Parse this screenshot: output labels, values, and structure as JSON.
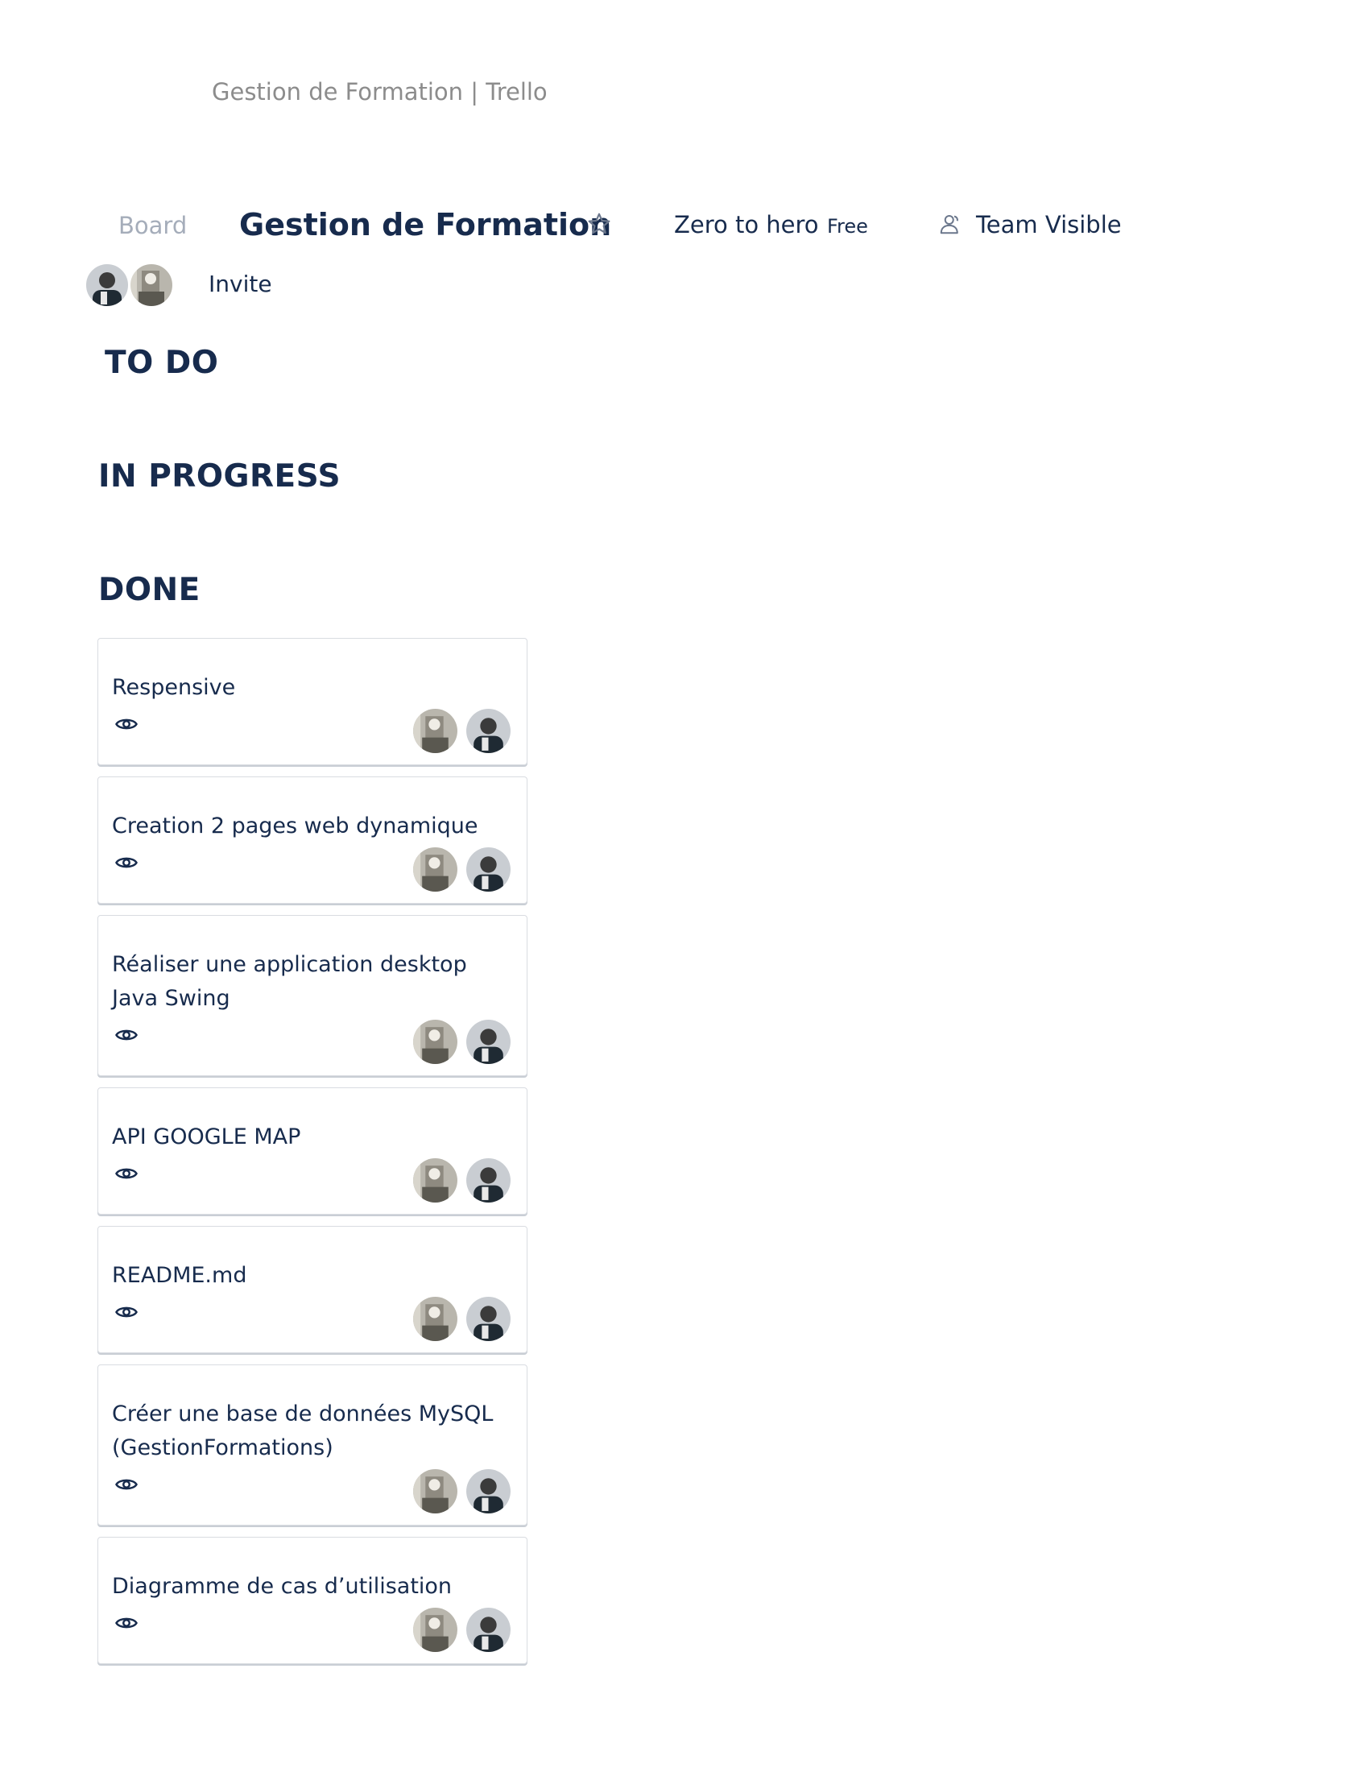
{
  "document": {
    "title": "Gestion de Formation | Trello"
  },
  "header": {
    "board_link": "Board",
    "board_title": "Gestion de Formation",
    "star_icon": "star-icon",
    "workspace": "Zero to hero",
    "plan": "Free",
    "visibility_icon": "team-icon",
    "visibility": "Team Visible"
  },
  "members": {
    "invite_label": "Invite"
  },
  "lists": [
    {
      "title": "TO DO",
      "cards": []
    },
    {
      "title": "IN PROGRESS",
      "cards": []
    },
    {
      "title": "DONE",
      "cards": [
        {
          "title": "Respensive"
        },
        {
          "title": "Creation 2 pages web dynamique"
        },
        {
          "title": "Réaliser une application desktop Java Swing"
        },
        {
          "title": "API GOOGLE MAP"
        },
        {
          "title": "README.md"
        },
        {
          "title": "Créer une base de données MySQL (GestionFormations)"
        },
        {
          "title": "Diagramme de cas d’utilisation"
        }
      ]
    }
  ],
  "colors": {
    "text": "#172b4d",
    "muted": "#a5adba",
    "card_border": "#d9dce1"
  }
}
